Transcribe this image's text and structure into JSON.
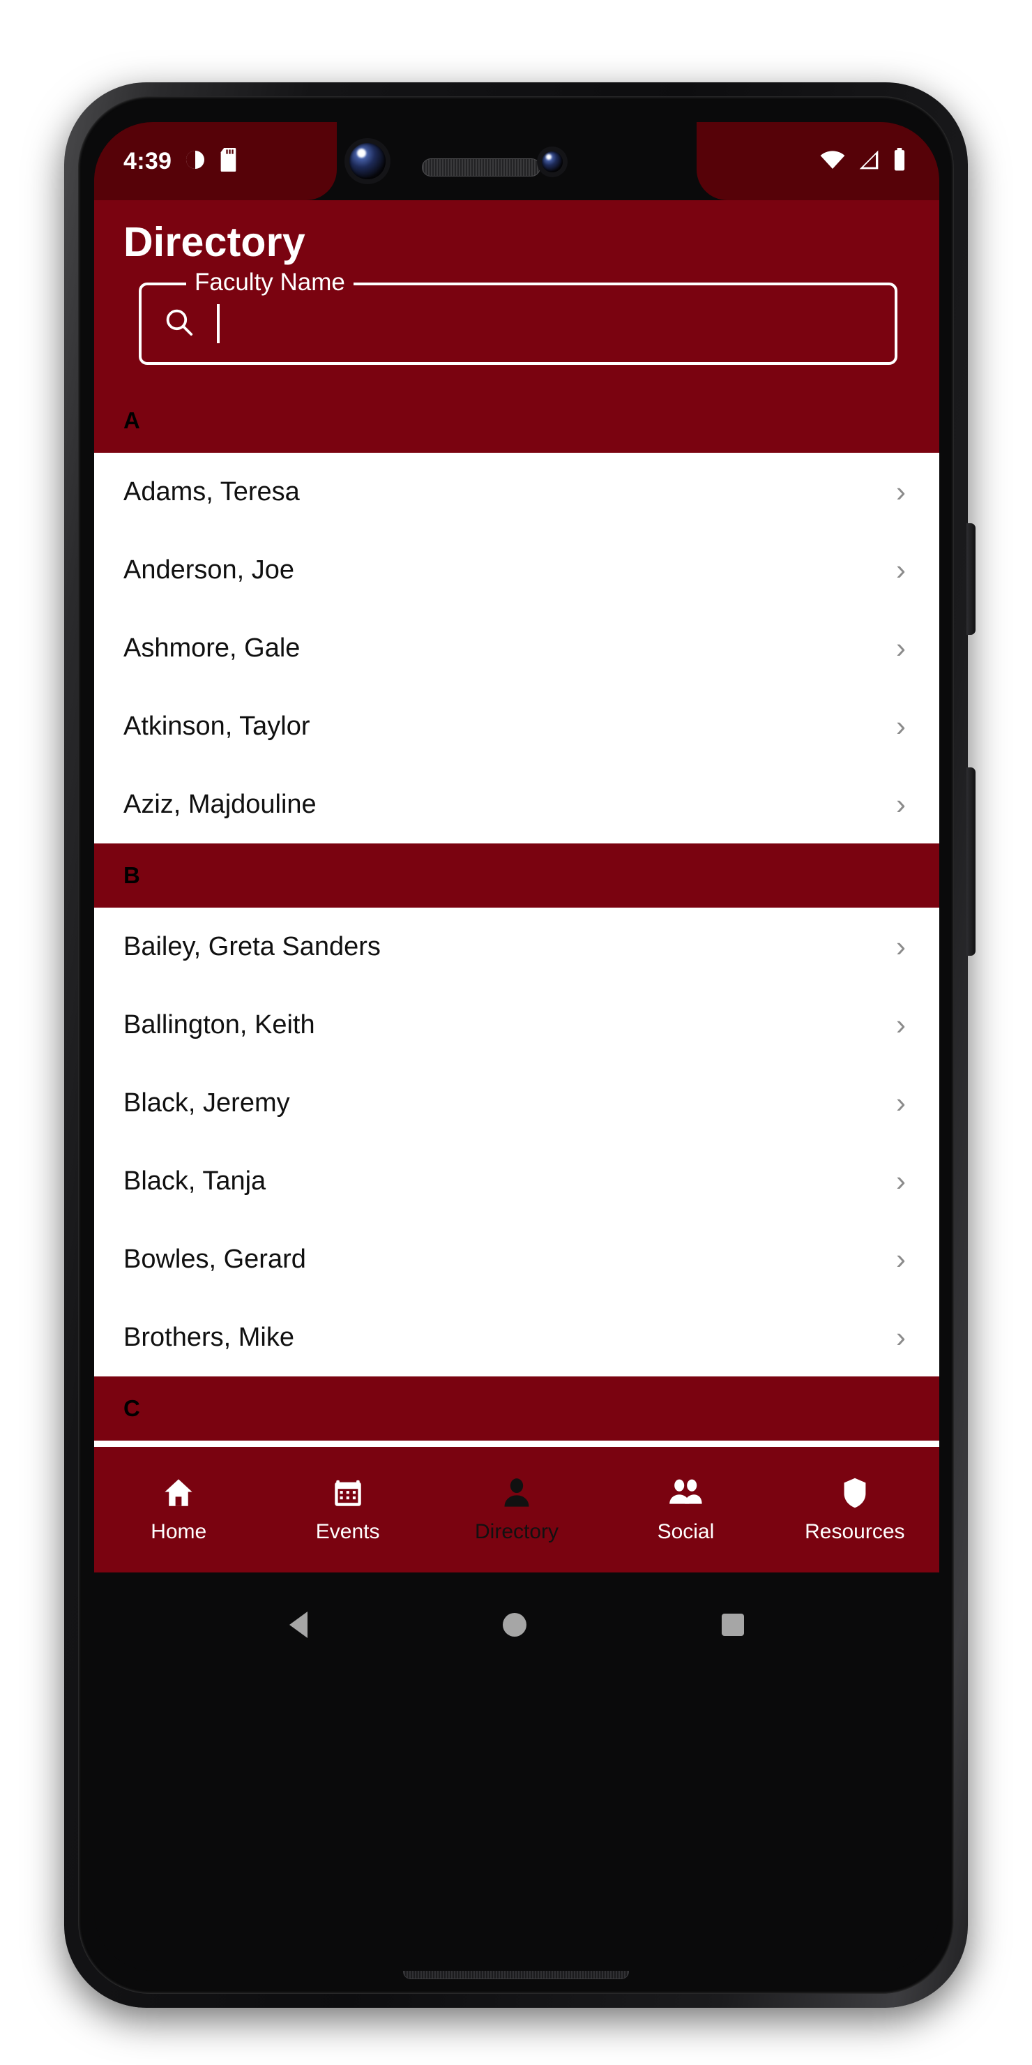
{
  "status_bar": {
    "time": "4:39",
    "left_icons": [
      "contrast-icon",
      "sd-card-icon"
    ],
    "right_icons": [
      "wifi-icon",
      "cellular-signal-icon",
      "battery-icon"
    ]
  },
  "header": {
    "title": "Directory"
  },
  "search": {
    "label": "Faculty Name",
    "value": "",
    "placeholder": "",
    "icon": "search-icon"
  },
  "sections": [
    {
      "letter": "A",
      "items": [
        {
          "name": "Adams, Teresa",
          "chevron": "›"
        },
        {
          "name": "Anderson, Joe",
          "chevron": "›"
        },
        {
          "name": "Ashmore, Gale",
          "chevron": "›"
        },
        {
          "name": "Atkinson, Taylor",
          "chevron": "›"
        },
        {
          "name": "Aziz, Majdouline",
          "chevron": "›"
        }
      ]
    },
    {
      "letter": "B",
      "items": [
        {
          "name": "Bailey, Greta Sanders",
          "chevron": "›"
        },
        {
          "name": "Ballington, Keith",
          "chevron": "›"
        },
        {
          "name": "Black, Jeremy",
          "chevron": "›"
        },
        {
          "name": "Black, Tanja",
          "chevron": "›"
        },
        {
          "name": "Bowles, Gerard",
          "chevron": "›"
        },
        {
          "name": "Brothers, Mike",
          "chevron": "›"
        }
      ]
    },
    {
      "letter": "C",
      "items": []
    }
  ],
  "bottom_nav": {
    "items": [
      {
        "label": "Home",
        "icon": "home-icon",
        "active": false
      },
      {
        "label": "Events",
        "icon": "calendar-icon",
        "active": false
      },
      {
        "label": "Directory",
        "icon": "person-icon",
        "active": true
      },
      {
        "label": "Social",
        "icon": "people-icon",
        "active": false
      },
      {
        "label": "Resources",
        "icon": "shield-icon",
        "active": false
      }
    ]
  },
  "android_nav": {
    "back": "back-triangle-icon",
    "home": "home-circle-icon",
    "recents": "recents-square-icon"
  },
  "colors": {
    "brand_maroon": "#7A0310",
    "status_bar_maroon": "#560208",
    "list_background": "#FFFFFF",
    "chevron_gray": "#8B8B8B",
    "active_nav_label": "#111111"
  }
}
